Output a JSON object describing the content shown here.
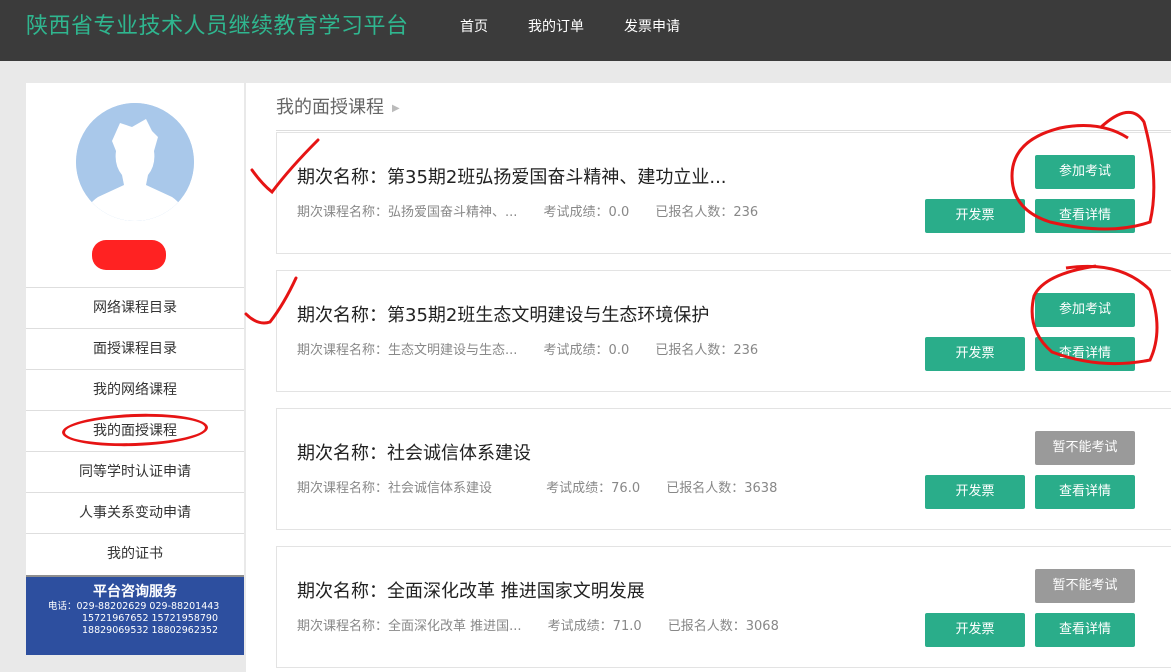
{
  "header": {
    "site_title": "陕西省专业技术人员继续教育学习平台",
    "nav": [
      "首页",
      "我的订单",
      "发票申请"
    ]
  },
  "sidebar": {
    "menu": [
      {
        "label": "网络课程目录"
      },
      {
        "label": "面授课程目录"
      },
      {
        "label": "我的网络课程"
      },
      {
        "label": "我的面授课程"
      },
      {
        "label": "同等学时认证申请"
      },
      {
        "label": "人事关系变动申请"
      },
      {
        "label": "我的证书"
      }
    ],
    "service": {
      "title": "平台咨询服务",
      "lines": [
        "电话：029-88202629  029-88201443",
        "15721967652   15721958790",
        "18829069532   18802962352"
      ]
    }
  },
  "main": {
    "heading": "我的面授课程",
    "cards": [
      {
        "title": "期次名称：第35期2班弘扬爱国奋斗精神、建功立业...",
        "course": "期次课程名称：弘扬爱国奋斗精神、...",
        "score": "考试成绩：0.0",
        "enrolled": "已报名人数：236",
        "exam_label": "参加考试",
        "exam_enabled": true,
        "invoice_label": "开发票",
        "detail_label": "查看详情"
      },
      {
        "title": "期次名称：第35期2班生态文明建设与生态环境保护",
        "course": "期次课程名称：生态文明建设与生态...",
        "score": "考试成绩：0.0",
        "enrolled": "已报名人数：236",
        "exam_label": "参加考试",
        "exam_enabled": true,
        "invoice_label": "开发票",
        "detail_label": "查看详情"
      },
      {
        "title": "期次名称：社会诚信体系建设",
        "course": "期次课程名称：社会诚信体系建设",
        "score": "考试成绩：76.0",
        "enrolled": "已报名人数：3638",
        "exam_label": "暂不能考试",
        "exam_enabled": false,
        "invoice_label": "开发票",
        "detail_label": "查看详情"
      },
      {
        "title": "期次名称：全面深化改革 推进国家文明发展",
        "course": "期次课程名称：全面深化改革 推进国...",
        "score": "考试成绩：71.0",
        "enrolled": "已报名人数：3068",
        "exam_label": "暂不能考试",
        "exam_enabled": false,
        "invoice_label": "开发票",
        "detail_label": "查看详情"
      }
    ]
  },
  "colors": {
    "accent": "#2aad8a",
    "title": "#2fb68f",
    "topbar": "#3b3b3b",
    "disabled": "#9a9a9a",
    "annotation": "#e61414"
  }
}
